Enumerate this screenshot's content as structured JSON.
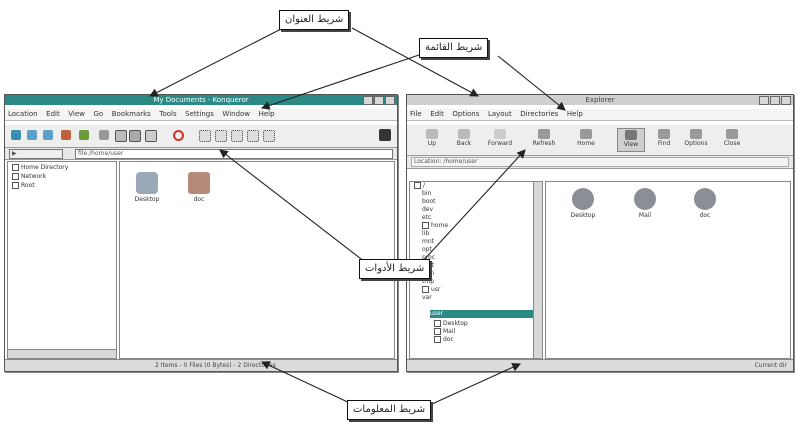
{
  "callouts": {
    "title_bar": "شريط العنوان",
    "menu_bar": "شريط القائمة",
    "toolbar": "شريط الأدوات",
    "status_bar": "شريط المعلومات"
  },
  "left_window": {
    "title": "My Documents - Konqueror",
    "menu": [
      "Location",
      "Edit",
      "View",
      "Go",
      "Bookmarks",
      "Tools",
      "Settings",
      "Window",
      "Help"
    ],
    "address": "file:/home/user",
    "tree": [
      "Home Directory",
      "Network",
      "Root"
    ],
    "files": [
      "Desktop",
      "doc"
    ],
    "status": "2 Items - 0 Files (0 Bytes) - 2 Directories"
  },
  "right_window": {
    "title": "Explorer",
    "menu": [
      "File",
      "Edit",
      "Options",
      "Layout",
      "Directories",
      "Help"
    ],
    "toolbar": [
      "Up",
      "Back",
      "Forward",
      "Refresh",
      "Home",
      "View",
      "Find",
      "Options",
      "Close"
    ],
    "location": "Location: /home/user",
    "tree": [
      "/",
      "bin",
      "boot",
      "dev",
      "etc",
      "home",
      "lib",
      "mnt",
      "opt",
      "proc",
      "root",
      "sbin",
      "tmp",
      "usr",
      "var",
      "user",
      "Desktop",
      "Mail",
      "doc"
    ],
    "selected_index": 15,
    "files": [
      "Desktop",
      "Mail",
      "doc"
    ],
    "status": "Current dir"
  },
  "colors": {
    "title_active": "#2c8a86",
    "selection": "#2c8a86"
  }
}
